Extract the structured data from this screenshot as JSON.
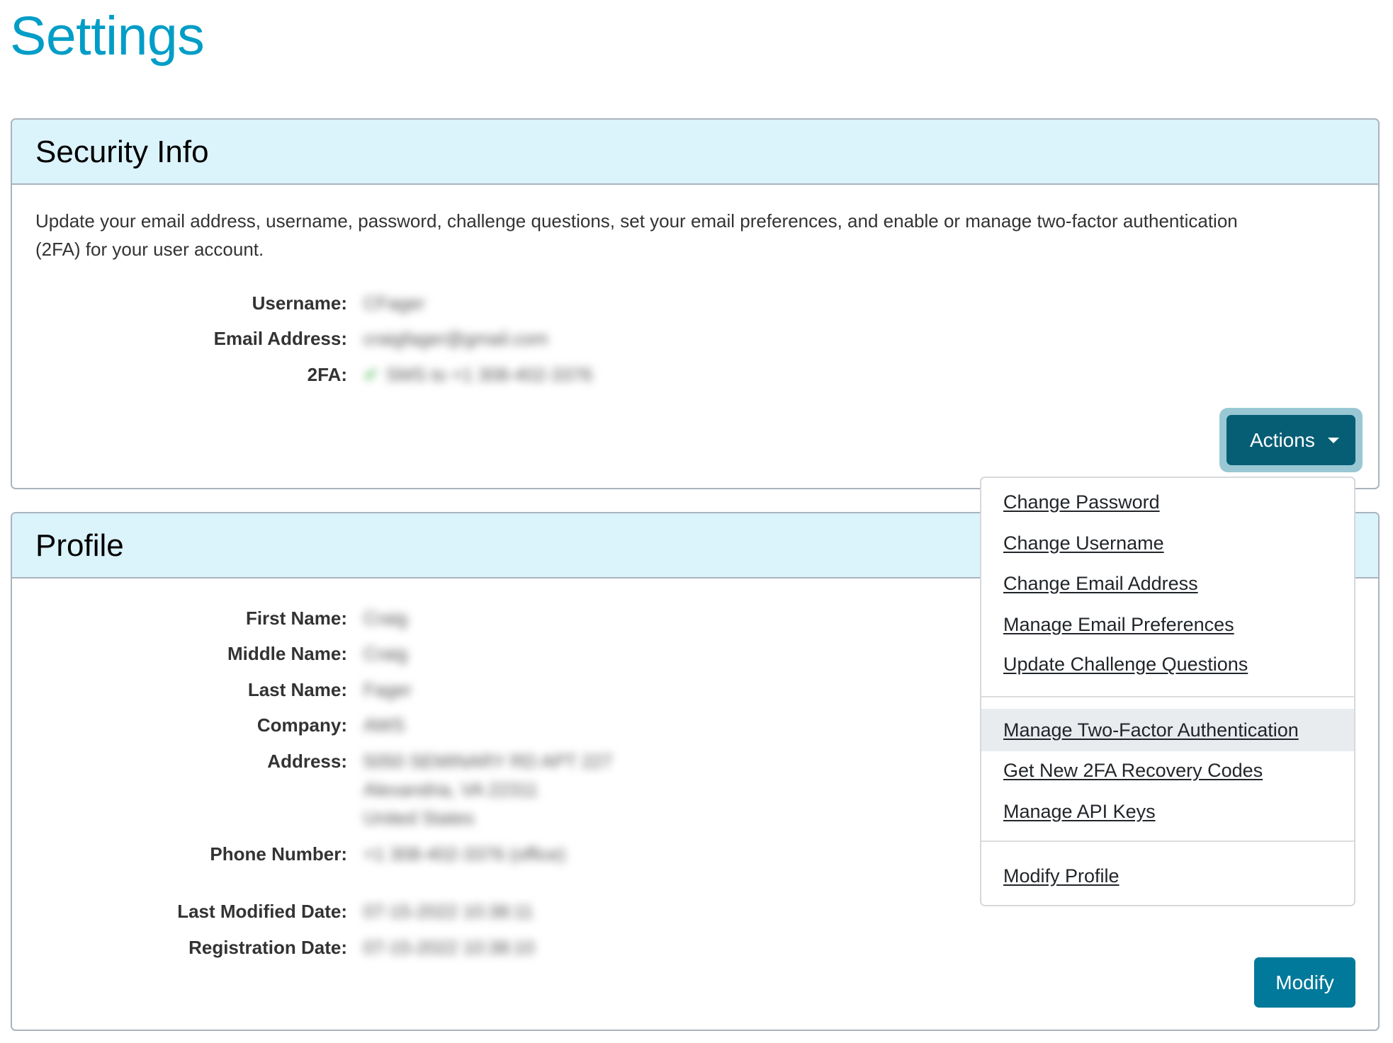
{
  "page": {
    "title": "Settings",
    "accent_color": "#009dc7"
  },
  "security": {
    "title": "Security Info",
    "description": "Update your email address, username, password, challenge questions, set your email preferences, and enable or manage two-factor authentication (2FA) for your user account.",
    "fields": [
      {
        "label": "Username:",
        "value": "CFager",
        "blurred": true
      },
      {
        "label": "Email Address:",
        "value": "craigfager@gmail.com",
        "blurred": true
      },
      {
        "label": "2FA:",
        "value": "SMS to +1 308-402-3376",
        "status_icon": "check-icon",
        "blurred": true
      }
    ],
    "actions_button": {
      "label": "Actions",
      "icon": "caret-down-icon",
      "state": "expanded"
    }
  },
  "actions_menu": {
    "groups": [
      [
        {
          "label": "Change Password"
        },
        {
          "label": "Change Username"
        },
        {
          "label": "Change Email Address"
        },
        {
          "label": "Manage Email Preferences"
        },
        {
          "label": "Update Challenge Questions"
        }
      ],
      [
        {
          "label": "Manage Two-Factor Authentication",
          "hovered": true
        },
        {
          "label": "Get New 2FA Recovery Codes"
        },
        {
          "label": "Manage API Keys"
        }
      ],
      [
        {
          "label": "Modify Profile"
        }
      ]
    ]
  },
  "profile": {
    "title": "Profile",
    "fields": [
      {
        "label": "First Name:",
        "value": "Craig",
        "blurred": true
      },
      {
        "label": "Middle Name:",
        "value": "Craig",
        "blurred": true
      },
      {
        "label": "Last Name:",
        "value": "Fager",
        "blurred": true
      },
      {
        "label": "Company:",
        "value": "AWS",
        "blurred": true
      },
      {
        "label": "Address:",
        "value_lines": [
          "5050 SEMINARY RD APT 227",
          "Alexandria, VA 22311",
          "United States"
        ],
        "blurred": true
      },
      {
        "label": "Phone Number:",
        "value": "+1 308-402-3376 (office)",
        "blurred": true
      },
      {
        "label": "Last Modified Date:",
        "value": "07-15-2022 10:38:11",
        "blurred": true
      },
      {
        "label": "Registration Date:",
        "value": "07-15-2022 10:38:10",
        "blurred": true
      }
    ],
    "modify_button": {
      "label": "Modify"
    }
  }
}
